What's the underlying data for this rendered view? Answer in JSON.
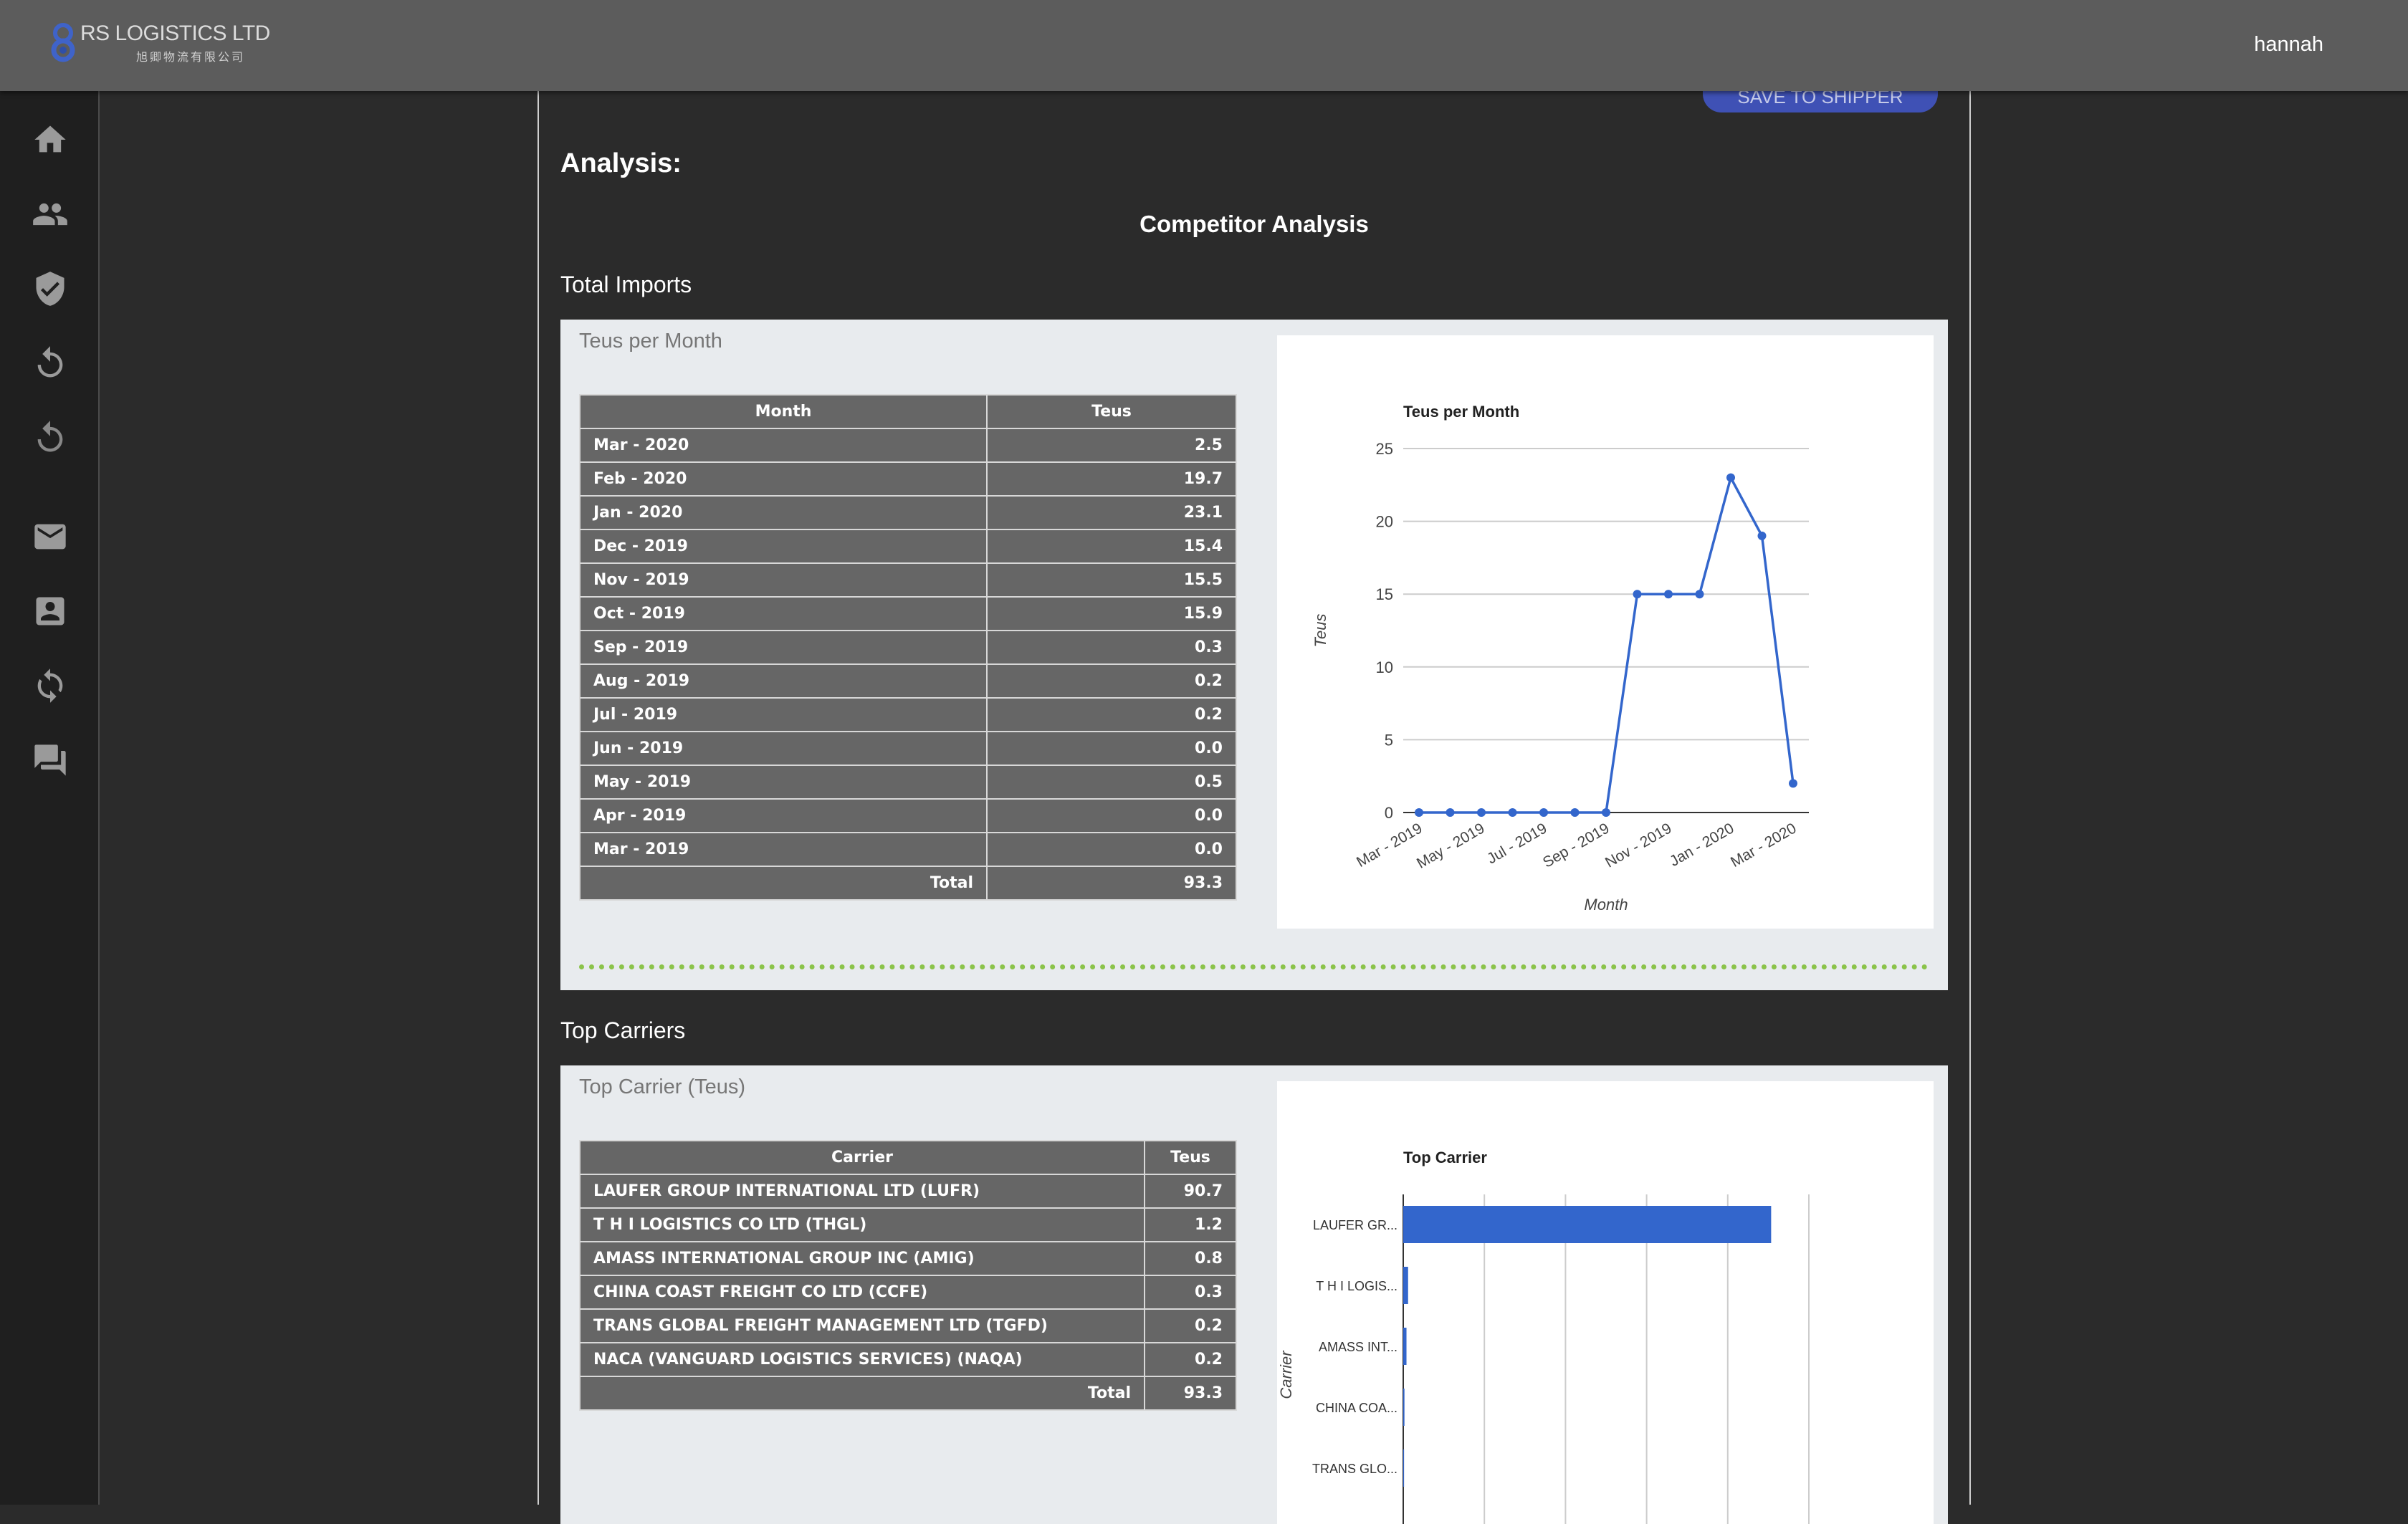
{
  "header": {
    "logo_title": "RS LOGISTICS LTD",
    "logo_subtitle": "旭卿物流有限公司",
    "user_name": "hannah"
  },
  "sidebar": {
    "items": [
      {
        "icon": "home-icon"
      },
      {
        "icon": "people-icon"
      },
      {
        "icon": "verified-icon"
      },
      {
        "icon": "refresh-dotted-icon"
      },
      {
        "icon": "refresh-dashed-icon"
      },
      {
        "icon": "mail-icon"
      },
      {
        "icon": "contact-card-icon"
      },
      {
        "icon": "sync-icon"
      },
      {
        "icon": "forum-icon"
      }
    ]
  },
  "main": {
    "save_button_label": "SAVE TO SHIPPER",
    "section_title": "Analysis:",
    "page_heading": "Competitor Analysis",
    "total_imports": {
      "title": "Total Imports",
      "card_title": "Teus per Month",
      "columns": [
        "Month",
        "Teus"
      ],
      "rows": [
        [
          "Mar - 2020",
          "2.5"
        ],
        [
          "Feb - 2020",
          "19.7"
        ],
        [
          "Jan - 2020",
          "23.1"
        ],
        [
          "Dec - 2019",
          "15.4"
        ],
        [
          "Nov - 2019",
          "15.5"
        ],
        [
          "Oct - 2019",
          "15.9"
        ],
        [
          "Sep - 2019",
          "0.3"
        ],
        [
          "Aug - 2019",
          "0.2"
        ],
        [
          "Jul - 2019",
          "0.2"
        ],
        [
          "Jun - 2019",
          "0.0"
        ],
        [
          "May - 2019",
          "0.5"
        ],
        [
          "Apr - 2019",
          "0.0"
        ],
        [
          "Mar - 2019",
          "0.0"
        ]
      ],
      "total_label": "Total",
      "total_value": "93.3"
    },
    "top_carriers": {
      "title": "Top Carriers",
      "card_title": "Top Carrier (Teus)",
      "columns": [
        "Carrier",
        "Teus"
      ],
      "rows": [
        [
          "LAUFER GROUP INTERNATIONAL LTD (LUFR)",
          "90.7"
        ],
        [
          "T H I LOGISTICS CO LTD (THGL)",
          "1.2"
        ],
        [
          "AMASS INTERNATIONAL GROUP INC (AMIG)",
          "0.8"
        ],
        [
          "CHINA COAST FREIGHT CO LTD (CCFE)",
          "0.3"
        ],
        [
          "TRANS GLOBAL FREIGHT MANAGEMENT LTD (TGFD)",
          "0.2"
        ],
        [
          "NACA (VANGUARD LOGISTICS SERVICES) (NAQA)",
          "0.2"
        ]
      ],
      "total_label": "Total",
      "total_value": "93.3"
    }
  },
  "chart_data": [
    {
      "type": "line",
      "title": "Teus per Month",
      "xlabel": "Month",
      "ylabel": "Teus",
      "x": [
        "Mar - 2019",
        "Apr - 2019",
        "May - 2019",
        "Jun - 2019",
        "Jul - 2019",
        "Aug - 2019",
        "Sep - 2019",
        "Oct - 2019",
        "Nov - 2019",
        "Dec - 2019",
        "Jan - 2020",
        "Feb - 2020",
        "Mar - 2020"
      ],
      "x_tick_labels": [
        "Mar - 2019",
        "May - 2019",
        "Jul - 2019",
        "Sep - 2019",
        "Nov - 2019",
        "Jan - 2020",
        "Mar - 2020"
      ],
      "values": [
        0.0,
        0.0,
        0.0,
        0.0,
        0.0,
        0.0,
        0.0,
        15.0,
        15.0,
        15.0,
        23.0,
        19.0,
        2.0
      ],
      "ylim": [
        0,
        25
      ],
      "y_ticks": [
        0,
        5,
        10,
        15,
        20,
        25
      ],
      "grid": true,
      "color": "#3366cc"
    },
    {
      "type": "bar",
      "orientation": "horizontal",
      "title": "Top Carrier",
      "ylabel": "Carrier",
      "categories": [
        "LAUFER GR...",
        "T H I LOGIS...",
        "AMASS INT...",
        "CHINA COA...",
        "TRANS GLO..."
      ],
      "values": [
        90.7,
        1.2,
        0.8,
        0.3,
        0.2
      ],
      "xlim": [
        0,
        100
      ],
      "grid": true,
      "color": "#3366cc"
    }
  ]
}
